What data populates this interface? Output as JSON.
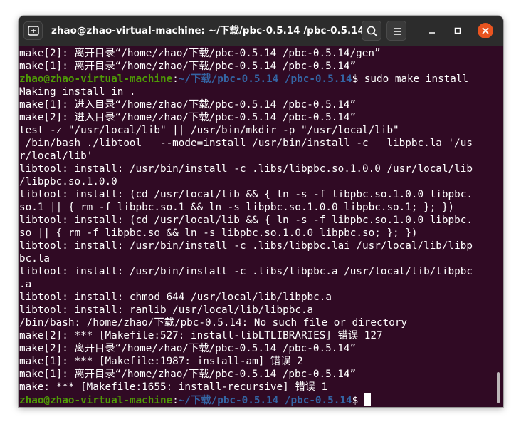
{
  "window": {
    "title": "zhao@zhao-virtual-machine: ~/下载/pbc-0.5.14 /pbc-0.5.14",
    "buttons": {
      "new_tab_icon": "new-tab-icon",
      "search_icon": "search-icon",
      "menu_icon": "hamburger-menu-icon",
      "minimize_icon": "minimize-icon",
      "maximize_icon": "maximize-icon",
      "close_icon": "close-icon"
    },
    "colors": {
      "titlebar": "#2c2c2c",
      "terminal_bg": "#300a24",
      "close": "#e95420",
      "prompt_user": "#4e9a06",
      "prompt_path": "#3465a4"
    }
  },
  "terminal": {
    "lines": [
      "make[2]: 离开目录“/home/zhao/下载/pbc-0.5.14 /pbc-0.5.14/gen”",
      "make[1]: 离开目录“/home/zhao/下载/pbc-0.5.14 /pbc-0.5.14”",
      "",
      "Making install in .",
      "make[1]: 进入目录“/home/zhao/下载/pbc-0.5.14 /pbc-0.5.14”",
      "make[2]: 进入目录“/home/zhao/下载/pbc-0.5.14 /pbc-0.5.14”",
      "test -z \"/usr/local/lib\" || /usr/bin/mkdir -p \"/usr/local/lib\"",
      " /bin/bash ./libtool   --mode=install /usr/bin/install -c   libpbc.la '/us",
      "r/local/lib'",
      "libtool: install: /usr/bin/install -c .libs/libpbc.so.1.0.0 /usr/local/lib",
      "/libpbc.so.1.0.0",
      "libtool: install: (cd /usr/local/lib && { ln -s -f libpbc.so.1.0.0 libpbc.",
      "so.1 || { rm -f libpbc.so.1 && ln -s libpbc.so.1.0.0 libpbc.so.1; }; })",
      "libtool: install: (cd /usr/local/lib && { ln -s -f libpbc.so.1.0.0 libpbc.",
      "so || { rm -f libpbc.so && ln -s libpbc.so.1.0.0 libpbc.so; }; })",
      "libtool: install: /usr/bin/install -c .libs/libpbc.lai /usr/local/lib/libp",
      "bc.la",
      "libtool: install: /usr/bin/install -c .libs/libpbc.a /usr/local/lib/libpbc",
      ".a",
      "libtool: install: chmod 644 /usr/local/lib/libpbc.a",
      "libtool: install: ranlib /usr/local/lib/libpbc.a",
      "/bin/bash: /home/zhao/下载/pbc-0.5.14: No such file or directory",
      "make[2]: *** [Makefile:527: install-libLTLIBRARIES] 错误 127",
      "make[2]: 离开目录“/home/zhao/下载/pbc-0.5.14 /pbc-0.5.14”",
      "make[1]: *** [Makefile:1987: install-am] 错误 2",
      "make[1]: 离开目录“/home/zhao/下载/pbc-0.5.14 /pbc-0.5.14”",
      "make: *** [Makefile:1655: install-recursive] 错误 1",
      ""
    ],
    "prompt1": {
      "user": "zhao@zhao-virtual-machine",
      "colon": ":",
      "path": "~/下载/pbc-0.5.14 /pbc-0.5.14",
      "dollar": "$",
      "command": " sudo make install"
    },
    "prompt2": {
      "user": "zhao@zhao-virtual-machine",
      "colon": ":",
      "path": "~/下载/pbc-0.5.14 /pbc-0.5.14",
      "dollar": "$",
      "command": " "
    }
  }
}
